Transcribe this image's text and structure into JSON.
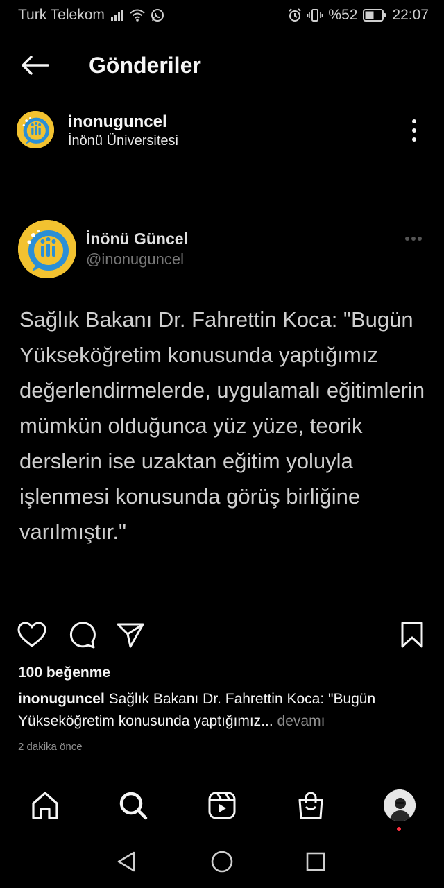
{
  "status_bar": {
    "carrier": "Turk Telekom",
    "battery_percent": "%52",
    "time": "22:07",
    "icons": [
      "signal-icon",
      "wifi-icon",
      "whatsapp-icon",
      "alarm-icon",
      "vibrate-icon",
      "battery-icon"
    ],
    "battery_level": 0.52
  },
  "header": {
    "title": "Gönderiler",
    "back_icon": "arrow-left-icon"
  },
  "post": {
    "username": "inonuguncel",
    "location": "İnönü Üniversitesi",
    "menu_icon": "more-vertical-icon",
    "image": {
      "display_name": "İnönü Güncel",
      "handle": "@inonuguncel",
      "text": "Sağlık Bakanı Dr. Fahrettin Koca: \"Bugün Yükseköğretim konusunda yaptığımız değerlendirmelerde, uygulamalı eğitimlerin mümkün olduğunca yüz yüze, teorik derslerin ise uzaktan eğitim yoluyla işlenmesi konusunda görüş birliğine varılmıştır.\""
    },
    "actions": {
      "like_icon": "heart-icon",
      "comment_icon": "comment-icon",
      "share_icon": "send-icon",
      "save_icon": "bookmark-icon"
    },
    "likes": "100 beğenme",
    "caption_user": "inonuguncel",
    "caption_text": " Sağlık Bakanı Dr. Fahrettin Koca: \"Bugün Yükseköğretim konusunda yaptığımız",
    "caption_ellipsis": "...",
    "caption_more": " devamı",
    "timestamp": "2 dakika önce"
  },
  "bottom_nav": {
    "items": [
      "home-icon",
      "search-icon",
      "reels-icon",
      "shop-icon",
      "profile-avatar"
    ]
  },
  "system_nav": {
    "items": [
      "back-triangle-icon",
      "home-circle-icon",
      "recents-square-icon"
    ]
  },
  "colors": {
    "background": "#000000",
    "text": "#f5f5f5",
    "muted": "#8e8e8e",
    "avatar_yellow": "#f2c230",
    "avatar_blue": "#2b8fd6",
    "notification": "#ff3040"
  }
}
